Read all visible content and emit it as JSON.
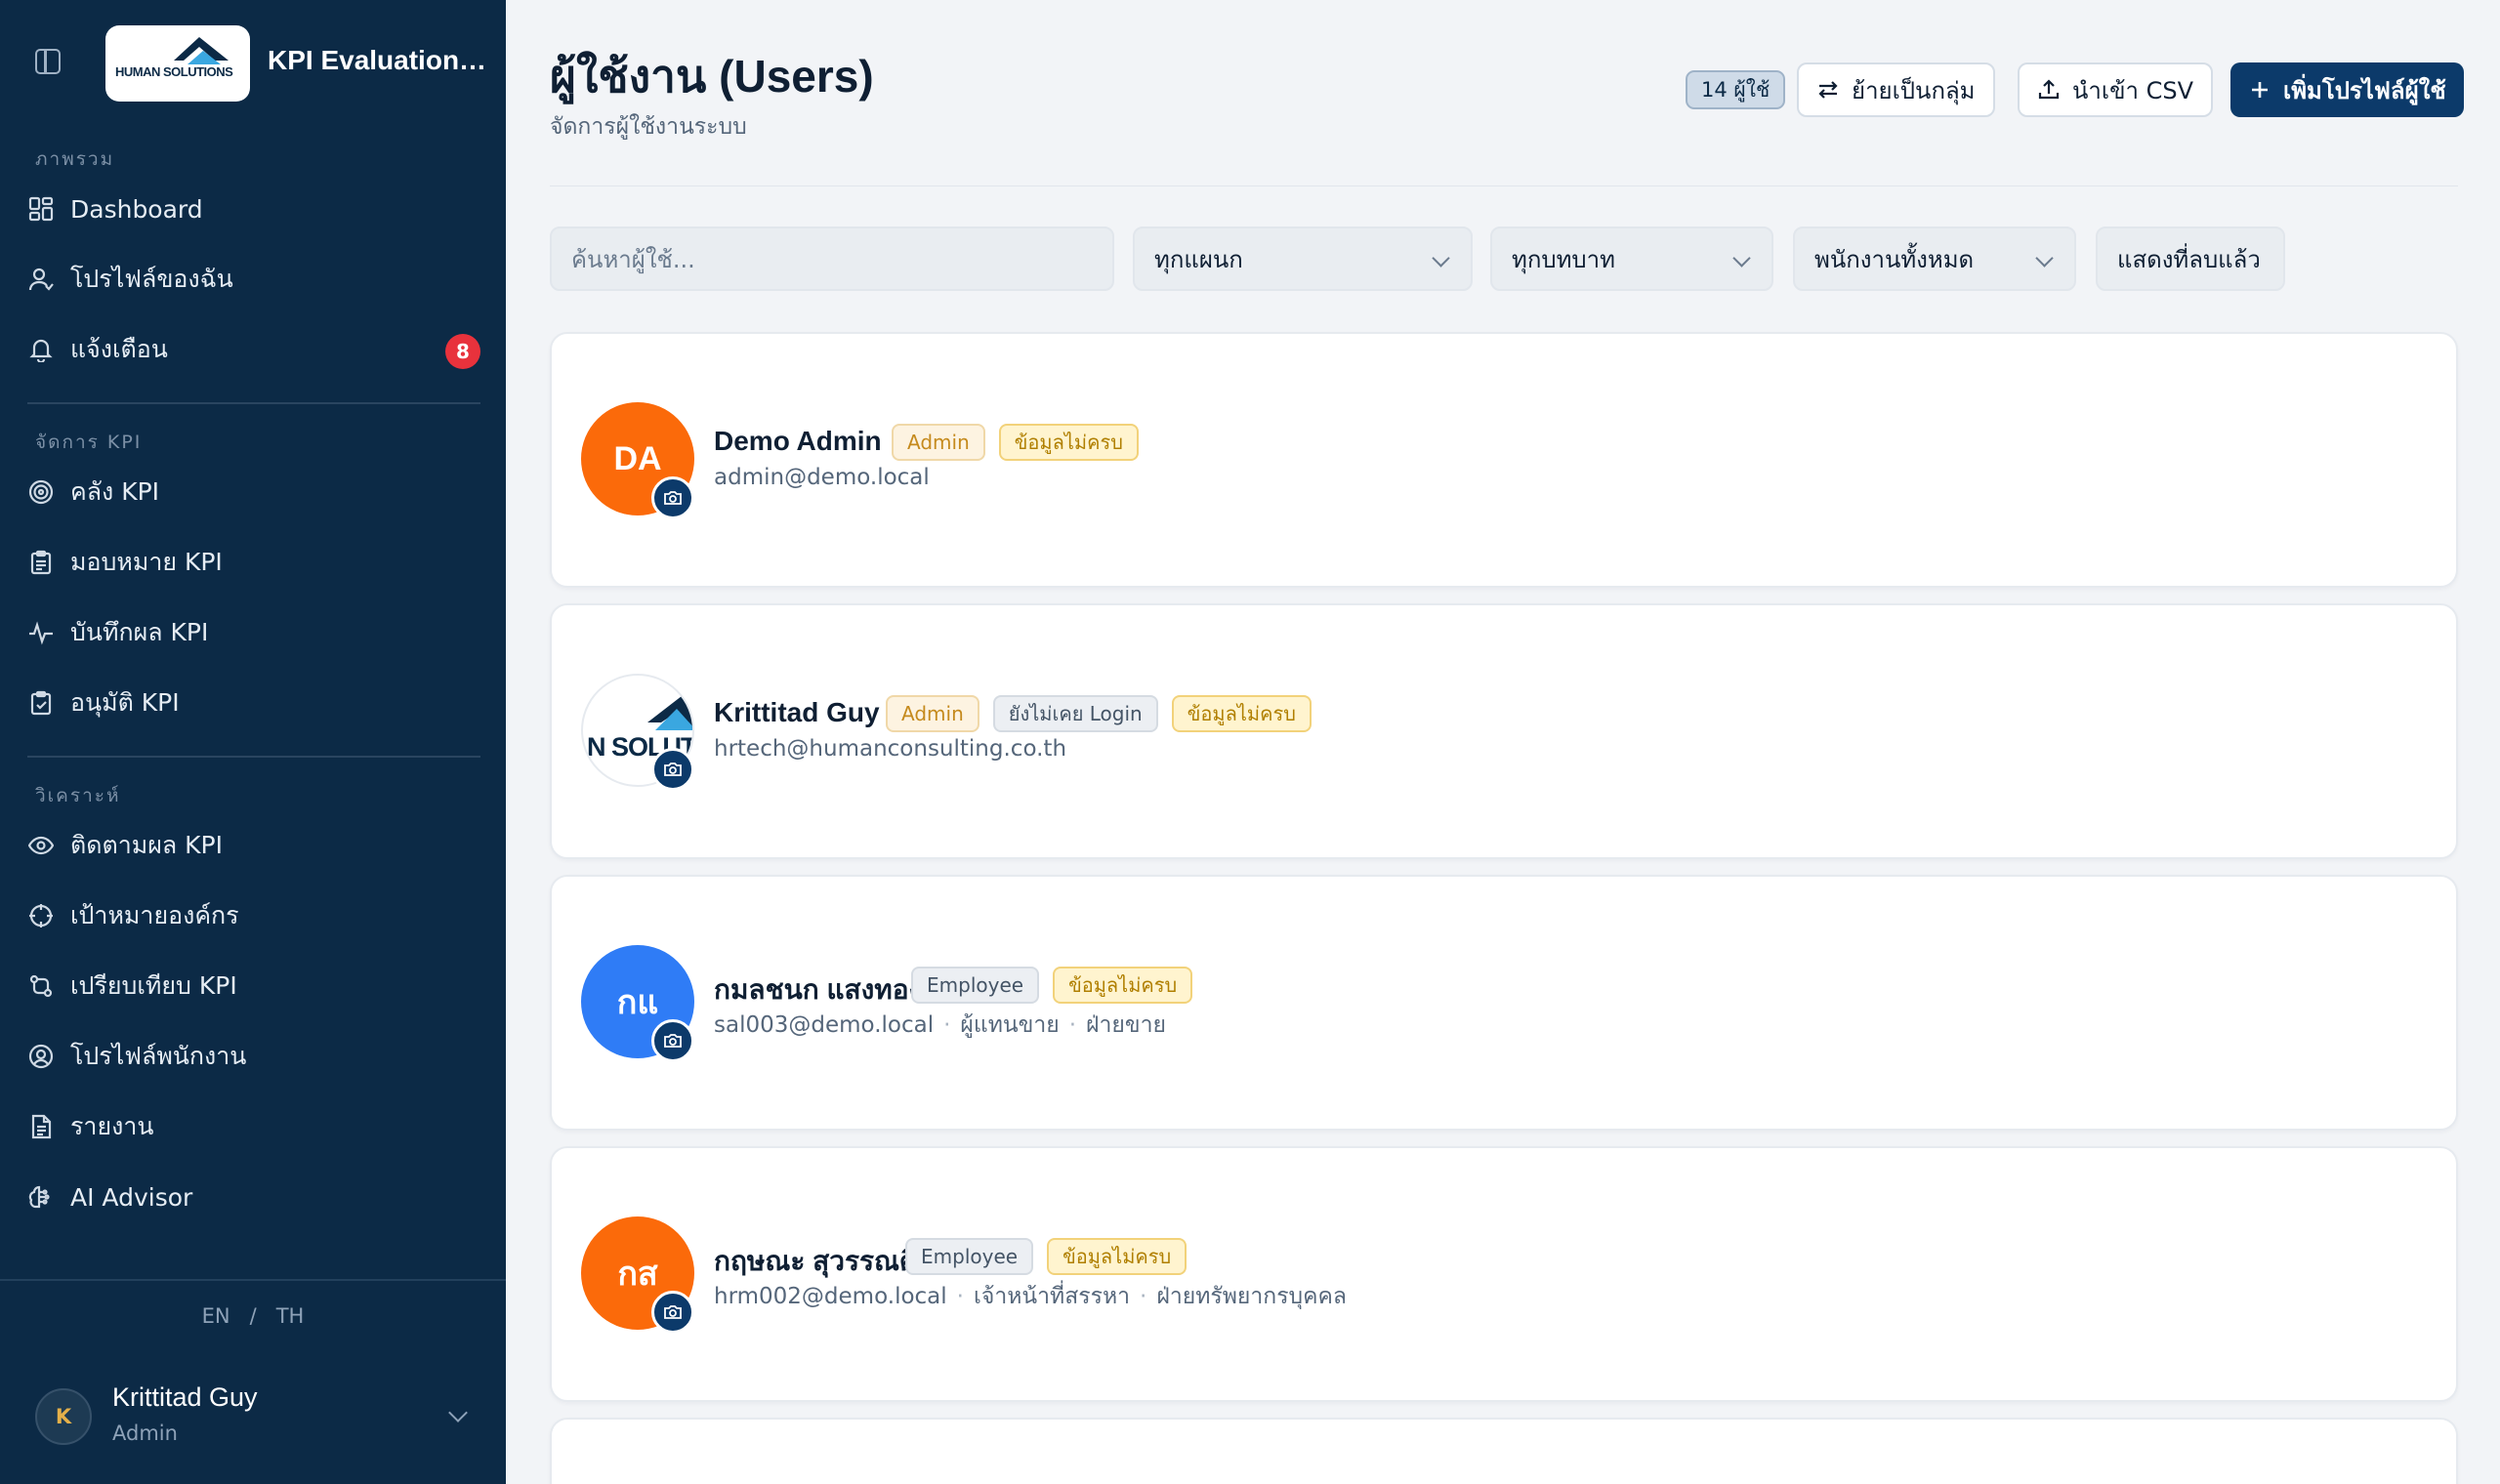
{
  "app": {
    "name": "KPI Evaluation ...",
    "logo_text": "HUMAN SOLUTIONS"
  },
  "sidebar": {
    "sections": [
      {
        "title": "ภาพรวม",
        "items": [
          {
            "label": "Dashboard",
            "icon": "dashboard-icon"
          },
          {
            "label": "โปรไฟล์ของฉัน",
            "icon": "user-icon"
          },
          {
            "label": "แจ้งเตือน",
            "icon": "bell-icon",
            "badge": "8"
          }
        ]
      },
      {
        "title": "จัดการ KPI",
        "items": [
          {
            "label": "คลัง KPI",
            "icon": "target-icon"
          },
          {
            "label": "มอบหมาย KPI",
            "icon": "clipboard-list-icon"
          },
          {
            "label": "บันทึกผล KPI",
            "icon": "activity-icon"
          },
          {
            "label": "อนุมัติ KPI",
            "icon": "clipboard-check-icon"
          }
        ]
      },
      {
        "title": "วิเคราะห์",
        "items": [
          {
            "label": "ติดตามผล KPI",
            "icon": "eye-icon"
          },
          {
            "label": "เป้าหมายองค์กร",
            "icon": "crosshair-icon"
          },
          {
            "label": "เปรียบเทียบ KPI",
            "icon": "compare-icon"
          },
          {
            "label": "โปรไฟล์พนักงาน",
            "icon": "user-circle-icon"
          },
          {
            "label": "รายงาน",
            "icon": "file-text-icon"
          },
          {
            "label": "AI Advisor",
            "icon": "brain-icon"
          }
        ]
      }
    ],
    "language": {
      "en": "EN",
      "separator": "/",
      "th": "TH"
    },
    "current_user": {
      "initial": "K",
      "name": "Krittitad Guy",
      "role": "Admin"
    }
  },
  "header": {
    "title": "ผู้ใช้งาน (Users)",
    "subtitle": "จัดการผู้ใช้งานระบบ",
    "count_badge": "14 ผู้ใช้",
    "bulk_move_label": "ย้ายเป็นกลุ่ม",
    "import_csv_label": "นำเข้า CSV",
    "add_user_label": "เพิ่มโปรไฟล์ผู้ใช้"
  },
  "filters": {
    "search_placeholder": "ค้นหาผู้ใช้...",
    "department": "ทุกแผนก",
    "role": "ทุกบทบาท",
    "employee_status": "พนักงานทั้งหมด",
    "show_deleted": "แสดงที่ลบแล้ว"
  },
  "users": [
    {
      "initials": "DA",
      "avatar_color": "#fb6a0a",
      "name": "Demo Admin",
      "email": "admin@demo.local",
      "tags": [
        {
          "label": "Admin",
          "kind": "admin"
        },
        {
          "label": "ข้อมูลไม่ครบ",
          "kind": "incomplete"
        }
      ],
      "position": "",
      "department": ""
    },
    {
      "initials": "",
      "avatar_logo_text": "N SOLUTIO",
      "name": "Krittitad Guy",
      "email": "hrtech@humanconsulting.co.th",
      "tags": [
        {
          "label": "Admin",
          "kind": "admin"
        },
        {
          "label": "ยังไม่เคย Login",
          "kind": "nologin"
        },
        {
          "label": "ข้อมูลไม่ครบ",
          "kind": "incomplete"
        }
      ],
      "position": "",
      "department": ""
    },
    {
      "initials": "กแ",
      "avatar_color": "#2f7cf6",
      "name": "กมลชนก แสงทอง",
      "email": "sal003@demo.local",
      "tags": [
        {
          "label": "Employee",
          "kind": "employee"
        },
        {
          "label": "ข้อมูลไม่ครบ",
          "kind": "incomplete"
        }
      ],
      "position": "ผู้แทนขาย",
      "department": "ฝ่ายขาย"
    },
    {
      "initials": "กส",
      "avatar_color": "#fb6a0a",
      "name": "กฤษณะ สุวรรณดี",
      "email": "hrm002@demo.local",
      "tags": [
        {
          "label": "Employee",
          "kind": "employee"
        },
        {
          "label": "ข้อมูลไม่ครบ",
          "kind": "incomplete"
        }
      ],
      "position": "เจ้าหน้าที่สรรหา",
      "department": "ฝ่ายทรัพยากรบุคคล"
    }
  ]
}
